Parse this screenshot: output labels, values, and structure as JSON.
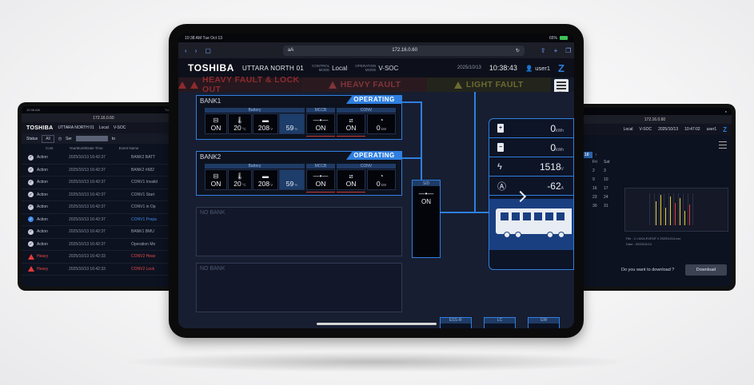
{
  "left": {
    "status_time": "10:38 AM",
    "status_date": "Tue Oct 13",
    "url_short": "aA",
    "url": "172.16.0.60",
    "brand": "TOSHIBA",
    "station": "UTTARA NORTH 01",
    "control_label": "CONTROL MODE",
    "control_value": "Local",
    "operation_label": "OPERATION MODE",
    "operation_value": "V-SOC",
    "filter_status_label": "Status",
    "filter_status_value": "All",
    "filter_ser_label": "Ser",
    "filter_to_label": "to",
    "col_cont": "Cont",
    "col_datetime": "YearMonthDate Time",
    "col_event": "Event Name",
    "rows": [
      {
        "status": "Action",
        "time": "2025/10/13 16:42:37",
        "event": "BANK2 BATT",
        "kind": "action"
      },
      {
        "status": "Action",
        "time": "2025/10/13 16:42:37",
        "event": "BANK2 #682",
        "kind": "action"
      },
      {
        "status": "Action",
        "time": "2025/10/13 16:42:37",
        "event": "CONV1 Invalid",
        "kind": "action"
      },
      {
        "status": "Action",
        "time": "2025/10/13 16:42:37",
        "event": "CONV1 Start",
        "kind": "action"
      },
      {
        "status": "Action",
        "time": "2025/10/13 16:42:37",
        "event": "CONV1 in Op",
        "kind": "action"
      },
      {
        "status": "Action",
        "time": "2025/10/13 16:42:37",
        "event": "CONV1 Prepa",
        "kind": "selected"
      },
      {
        "status": "Action",
        "time": "2025/10/13 16:42:37",
        "event": "BANK1 BMU",
        "kind": "action"
      },
      {
        "status": "Action",
        "time": "2025/10/13 16:42:37",
        "event": "Operation Mo",
        "kind": "action"
      },
      {
        "status": "Heavy",
        "time": "2025/10/13 16:42:33",
        "event": "CONV2 Heav",
        "kind": "heavy"
      },
      {
        "status": "Heavy",
        "time": "2025/10/13 16:42:33",
        "event": "CONV2 Lock",
        "kind": "heavy"
      }
    ]
  },
  "right": {
    "url": "172.16.0.60",
    "control_value": "Local",
    "operation_label": "OPERATION MODE",
    "operation_value": "V-SOC",
    "date": "2025/10/13",
    "time": "10:47:02",
    "user": "user1",
    "cal_selected": "10",
    "cal_fri": "Fri",
    "cal_sat": "Sat",
    "cal_days": [
      "2",
      "3",
      "9",
      "10",
      "16",
      "17",
      "23",
      "24",
      "30",
      "31"
    ],
    "file_label": "File",
    "file_value": "C:\\ AKA EVENT \\\\ 2025\\1013.csv",
    "date_label": "Date",
    "date_value": "2025/10/13",
    "download_question": "Do you want to download ?",
    "download_button": "Download"
  },
  "main": {
    "status_time": "10:38 AM",
    "status_date": "Tue Oct 13",
    "battery": "65%",
    "url_short": "aA",
    "url": "172.16.0.60",
    "brand": "TOSHIBA",
    "station": "UTTARA NORTH 01",
    "control_label_1": "CONTROL",
    "control_label_2": "MODE",
    "control_value": "Local",
    "operation_label_1": "OPERATION",
    "operation_label_2": "MODE",
    "operation_value": "V-SOC",
    "date": "2025/10/13",
    "time": "10:38:43",
    "user": "user1",
    "alarm_heavy_lock": "HEAVY FAULT & LOCK OUT",
    "alarm_heavy": "HEAVY FAULT",
    "alarm_light": "LIGHT FAULT",
    "menu_label": "MENU",
    "banks": [
      {
        "name": "BANK1",
        "state": "OPERATING",
        "battery_hdr": "Battery",
        "mccb_hdr": "MCCB",
        "conv_hdr": "CONV",
        "batt_on": "ON",
        "temp": "20",
        "temp_unit": "°C",
        "volt": "208",
        "volt_unit": "V",
        "soc": "59",
        "soc_unit": "%",
        "mccb": "ON",
        "conv_on": "ON",
        "power": "0",
        "power_unit": "kW"
      },
      {
        "name": "BANK2",
        "state": "OPERATING",
        "battery_hdr": "Battery",
        "mccb_hdr": "MCCB",
        "conv_hdr": "CONV",
        "batt_on": "ON",
        "temp": "20",
        "temp_unit": "°C",
        "volt": "208",
        "volt_unit": "V",
        "soc": "59",
        "soc_unit": "%",
        "mccb": "ON",
        "conv_on": "ON",
        "power": "0",
        "power_unit": "kW"
      }
    ],
    "no_bank_1": "NO BANK",
    "no_bank_2": "NO BANK",
    "sd_header": "S/D",
    "sd_value": "ON",
    "readings": [
      {
        "icon": "battery-plus",
        "value": "0",
        "unit": "kWh"
      },
      {
        "icon": "battery-minus",
        "value": "0",
        "unit": "kWh"
      },
      {
        "icon": "lightning",
        "value": "1518",
        "unit": "V"
      },
      {
        "icon": "ampere",
        "value": "-62",
        "unit": "A"
      }
    ],
    "bottom_1": "ESS-IF",
    "bottom_2": "LC",
    "bottom_3": "GW"
  },
  "colors": {
    "accent": "#2f7fe0",
    "heavy": "#e23b3b",
    "light": "#6a6a30",
    "bg": "#171e31"
  }
}
